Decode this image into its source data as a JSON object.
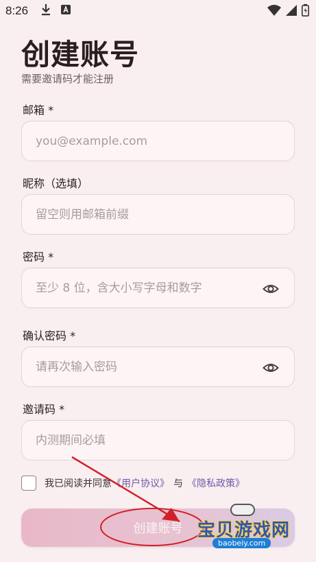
{
  "status_bar": {
    "time": "8:26"
  },
  "header": {
    "title": "创建账号",
    "subtitle": "需要邀请码才能注册"
  },
  "form": {
    "email": {
      "label": "邮箱 *",
      "value": "",
      "placeholder": "you@example.com"
    },
    "nickname": {
      "label": "昵称（选填）",
      "value": "",
      "placeholder": "留空则用邮箱前缀"
    },
    "password": {
      "label": "密码 *",
      "value": "",
      "placeholder": "至少 8 位，含大小写字母和数字"
    },
    "confirm_password": {
      "label": "确认密码 *",
      "value": "",
      "placeholder": "请再次输入密码"
    },
    "invite_code": {
      "label": "邀请码 *",
      "value": "",
      "placeholder": "内测期间必填"
    }
  },
  "agreement": {
    "checked": false,
    "prefix": "我已阅读并同意",
    "terms_link": "《用户协议》",
    "conjunction": "与",
    "privacy_link": "《隐私政策》"
  },
  "submit": {
    "label": "创建账号"
  },
  "watermark": {
    "text": "宝贝游戏网",
    "url": "baobeiy.com"
  },
  "colors": {
    "background": "#f9eef0",
    "link": "#6f5aa8",
    "button_gradient_start": "#e9b8c8",
    "button_gradient_end": "#d9cbe6",
    "annotation": "#d0202a"
  },
  "icons": [
    "download-icon",
    "text-a-icon",
    "wifi-icon",
    "signal-icon",
    "battery-icon",
    "eye-icon"
  ]
}
